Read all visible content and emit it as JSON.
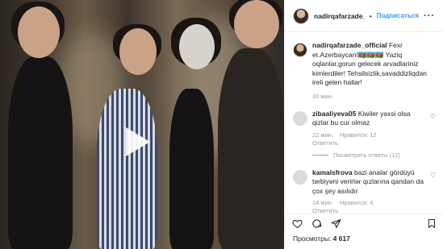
{
  "media": {
    "play_icon": "play-icon"
  },
  "post": {
    "username": "nadirqafarzade_offi",
    "separator": "•",
    "follow_label": "Подписаться",
    "more_icon": "ellipsis-icon",
    "caption_username": "nadirqafarzade_official",
    "caption_text": "Fexr et.Azerbaycan!🇦🇿🇦🇿🇦🇿 Yaziq oqlanlar,gorun gelecek arvadlariniz kimlerdiler! Tehsilsizlik,savaddizliqdan ireli gelen hallar!",
    "time": "30 мин."
  },
  "comments": [
    {
      "username": "zibaaliyeva05",
      "text": "Kiwiler yaxsi olsa qizlar bu cur olmaz",
      "time": "22 мин.",
      "likes": "Нравится: 12",
      "reply": "Ответить",
      "replies": "Посмотреть ответы (12)"
    },
    {
      "username": "kamalsfrova",
      "text": "bazi analar gördüyü tərbiyəni verirlər qızlarına qandan da çox şey asılıdır",
      "time": "14 мин.",
      "likes": "Нравится: 4",
      "reply": "Ответить"
    }
  ],
  "actions": {
    "like_icon": "heart-icon",
    "comment_icon": "comment-icon",
    "share_icon": "share-icon",
    "save_icon": "bookmark-icon"
  },
  "views": {
    "label": "Просмотры:",
    "count": "4 617"
  }
}
